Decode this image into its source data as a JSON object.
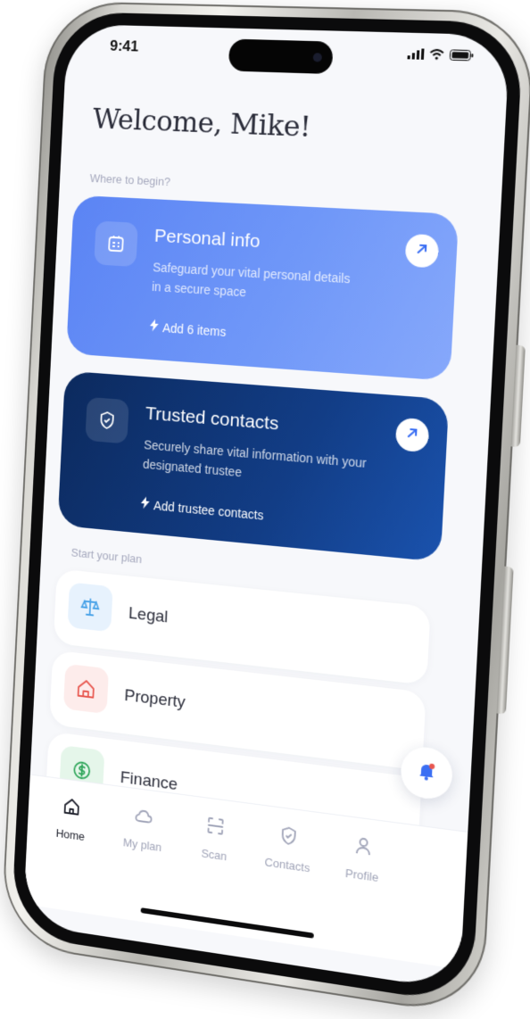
{
  "status_bar": {
    "time": "9:41"
  },
  "greeting": "Welcome, Mike!",
  "sections": {
    "begin_label": "Where to begin?",
    "plan_label": "Start your plan"
  },
  "cards": [
    {
      "title": "Personal info",
      "description": "Safeguard your vital personal details in a secure space",
      "action": "Add 6 items",
      "icon": "id-badge-icon"
    },
    {
      "title": "Trusted contacts",
      "description": "Securely share vital information with your designated trustee",
      "action": "Add trustee contacts",
      "icon": "shield-check-icon"
    }
  ],
  "plan_items": [
    {
      "label": "Legal",
      "icon": "scales-icon",
      "icon_color": "#4aa3e8"
    },
    {
      "label": "Property",
      "icon": "house-icon",
      "icon_color": "#e8574f"
    },
    {
      "label": "Finance",
      "icon": "dollar-icon",
      "icon_color": "#2fa65a"
    }
  ],
  "tabs": [
    {
      "label": "Home",
      "icon": "home-icon",
      "active": true
    },
    {
      "label": "My plan",
      "icon": "cloud-icon",
      "active": false
    },
    {
      "label": "Scan",
      "icon": "scan-icon",
      "active": false
    },
    {
      "label": "Contacts",
      "icon": "shield-check-icon",
      "active": false
    },
    {
      "label": "Profile",
      "icon": "person-icon",
      "active": false
    }
  ],
  "colors": {
    "card_blue": "#5b84f4",
    "card_navy": "#0c2a5e",
    "accent": "#3b6ff3",
    "notification_dot": "#e8574f"
  }
}
